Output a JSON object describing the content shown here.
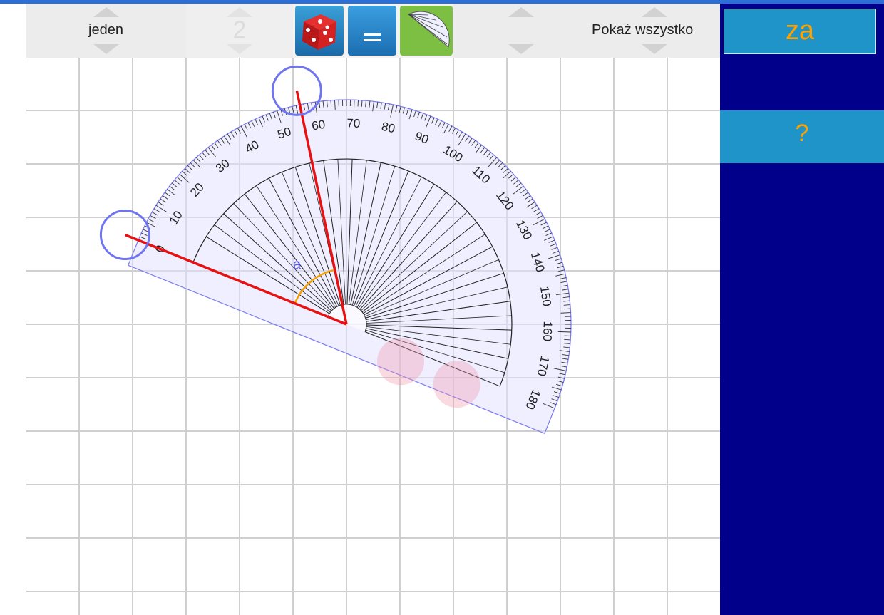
{
  "toolbar": {
    "mode_spinner_label": "jeden",
    "count_spinner_value": "2",
    "show_all_label": "Pokaż wszystko"
  },
  "sidebar": {
    "answer_button_label": "za",
    "help_button_label": "?"
  },
  "protractor": {
    "angle_label": "a",
    "scale_numbers": [
      "0",
      "10",
      "20",
      "30",
      "40",
      "50",
      "60",
      "70",
      "80",
      "90",
      "100",
      "110",
      "120",
      "130",
      "140",
      "150",
      "160",
      "170",
      "180"
    ],
    "measured_angle_deg": 56
  },
  "colors": {
    "sidebar_bg": "#00008b",
    "sidebar_button_bg": "#1e94c8",
    "sidebar_button_text": "#ffa200",
    "ray_color": "#e81010",
    "handle_color": "#6f75f0",
    "angle_arc_color": "#f5a000"
  },
  "icons": [
    "dice-icon",
    "equals-icon",
    "protractor-icon",
    "arrow-up-icon",
    "arrow-down-icon"
  ]
}
